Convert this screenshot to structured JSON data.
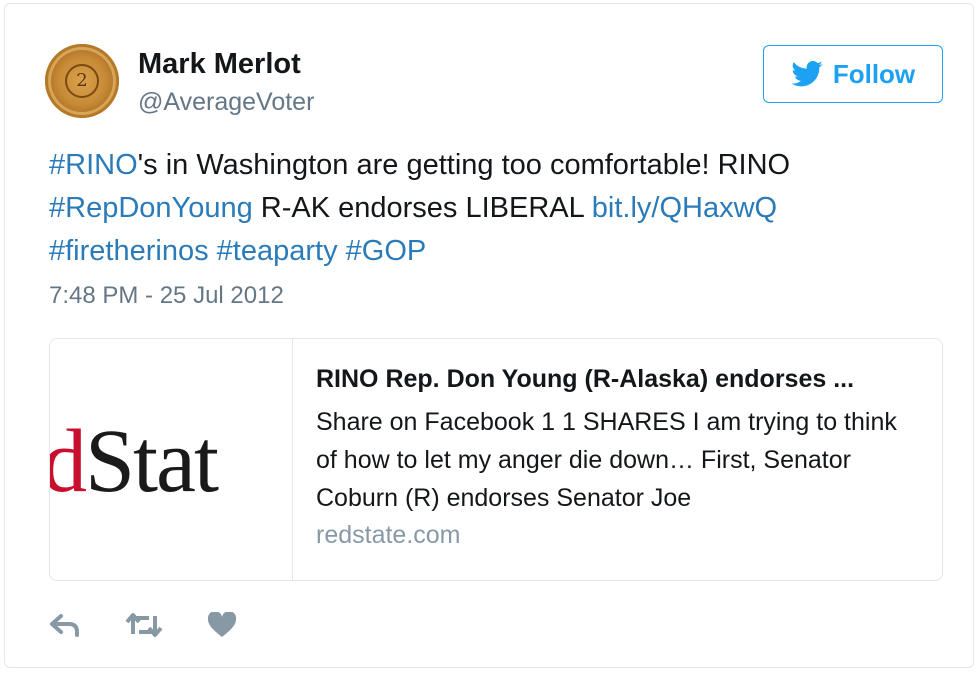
{
  "user": {
    "name": "Mark Merlot",
    "handle": "@AverageVoter",
    "avatar_text": "2"
  },
  "follow_button": {
    "label": "Follow"
  },
  "tweet": {
    "segments": [
      {
        "text": "#RINO",
        "link": true
      },
      {
        "text": "'s in Washington are getting too comfortable! RINO ",
        "link": false
      },
      {
        "text": "#RepDonYoung",
        "link": true
      },
      {
        "text": " R-AK endorses LIBERAL ",
        "link": false
      },
      {
        "text": "bit.ly/QHaxwQ",
        "link": true
      },
      {
        "text": " ",
        "link": false
      },
      {
        "text": "#firetherinos",
        "link": true
      },
      {
        "text": " ",
        "link": false
      },
      {
        "text": "#teaparty",
        "link": true
      },
      {
        "text": " ",
        "link": false
      },
      {
        "text": "#GOP",
        "link": true
      }
    ],
    "timestamp": "7:48 PM - 25 Jul 2012"
  },
  "card": {
    "logo_red": "ed",
    "logo_black": "Stat",
    "title": "RINO Rep. Don Young (R-Alaska) endorses ...",
    "description": "Share on Facebook 1 1 SHARES I am trying to think of how to let my anger die down… First, Senator Coburn (R) endorses Senator Joe",
    "domain": "redstate.com"
  },
  "colors": {
    "link": "#2b7bb9",
    "follow": "#1da1f2",
    "muted": "#657786",
    "icon": "#8899a6"
  },
  "actions": [
    {
      "icon": "reply-icon"
    },
    {
      "icon": "retweet-icon"
    },
    {
      "icon": "heart-icon"
    }
  ]
}
